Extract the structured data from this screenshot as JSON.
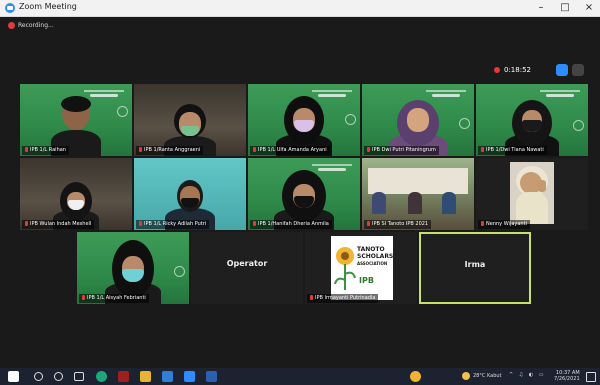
{
  "window": {
    "title": "Zoom Meeting",
    "minimize": "–",
    "maximize": "□",
    "close": "×"
  },
  "recording": {
    "label": "Recording..."
  },
  "status": {
    "timer": "0:18:52"
  },
  "participants": [
    {
      "name": "IPB 1/L Raihan"
    },
    {
      "name": "IPB 1/Ranta Anggraeni"
    },
    {
      "name": "IPB 1/L Ulfa Amanda Aryani"
    },
    {
      "name": "IPB Dwi Putri Pitaningrum"
    },
    {
      "name": "IPB 1/Dwi Tiana Nawati"
    },
    {
      "name": "IPB Wulan Indah Meshell"
    },
    {
      "name": "IPB 1/L Ricky Adilah Putri"
    },
    {
      "name": "IPB 1/Hanifah Dheria Anmila"
    },
    {
      "name": "IPB SI Tanoto IPB 2021"
    },
    {
      "name": "Nenny Wijayanti"
    },
    {
      "name": "IPB 1/L Aisyah Febrianti"
    },
    {
      "name": "Operator"
    },
    {
      "name": "IPB Irmayanti Putrinadia"
    },
    {
      "name": "Irma"
    }
  ],
  "logo": {
    "line1": "TANOTO",
    "line2": "SCHOLARS",
    "line3": "ASSOCIATION",
    "line4": "IPB"
  },
  "taskbar": {
    "weather": "28°C Kabut",
    "time": "10:37 AM",
    "date": "7/26/2021"
  }
}
